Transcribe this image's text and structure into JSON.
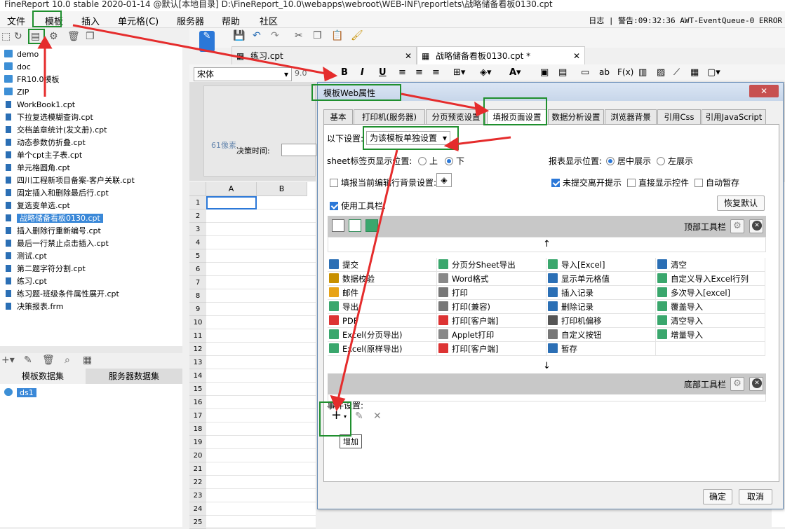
{
  "titlebar": {
    "text": "FineReport 10.0 stable 2020-01-14 @默认[本地目录]   D:\\FineReport_10.0\\webapps\\webroot\\WEB-INF\\reportlets\\战略储备看板0130.cpt"
  },
  "menubar": {
    "items": [
      "文件",
      "模板",
      "插入",
      "单元格(C)",
      "服务器",
      "帮助",
      "社区"
    ],
    "log": "日志",
    "alert": "警告:09:32:36 AWT-EventQueue-0 ERROR"
  },
  "tree": {
    "folders": [
      "demo",
      "doc",
      "FR10.0模板",
      "ZIP"
    ],
    "files": [
      "WorkBook1.cpt",
      "下拉复选模糊查询.cpt",
      "交档盖章统计(发文册).cpt",
      "动态参数仿折叠.cpt",
      "单个cpt主子表.cpt",
      "单元格圆角.cpt",
      "四川工程新项目备案-客户关联.cpt",
      "固定插入和删除最后行.cpt",
      "复选变单选.cpt",
      "战略储备看板0130.cpt",
      "插入删除行重新编号.cpt",
      "最后一行禁止点击插入.cpt",
      "测试.cpt",
      "第二题字符分割.cpt",
      "练习.cpt",
      "练习题-班级条件属性展开.cpt",
      "决策报表.frm"
    ],
    "selected_index": 9
  },
  "datasets": {
    "tabs": [
      "模板数据集",
      "服务器数据集"
    ],
    "items": [
      "ds1"
    ]
  },
  "file_tabs": [
    "练习.cpt",
    "战略储备看板0130.cpt *"
  ],
  "format": {
    "font": "宋体",
    "size": "9.0"
  },
  "design": {
    "label_px": "61像素",
    "decision_time": "决策时间:"
  },
  "sheet": {
    "cols": [
      "A",
      "B"
    ],
    "rows": [
      "1",
      "2",
      "3",
      "4",
      "5",
      "6",
      "7",
      "8",
      "9",
      "10",
      "11",
      "12",
      "13",
      "14",
      "15",
      "16",
      "17",
      "18",
      "19",
      "20",
      "21",
      "22",
      "23",
      "24",
      "25"
    ]
  },
  "dialog": {
    "title": "模板Web属性",
    "close": "✕",
    "tabs": [
      "基本",
      "打印机(服务器)",
      "分页预览设置",
      "填报页面设置",
      "数据分析设置",
      "浏览器背景",
      "引用Css",
      "引用JavaScript"
    ],
    "active_tab": "填报页面设置",
    "mode_label": "以下设置:",
    "mode_value": "为该模板单独设置",
    "sheet_pos_label": "sheet标签页显示位置:",
    "sheet_pos_top": "上",
    "sheet_pos_bottom": "下",
    "report_pos_label": "报表显示位置:",
    "report_pos_center": "居中展示",
    "report_pos_left": "左展示",
    "fill_bg": "填报当前编辑行背景设置:",
    "unsubmitted": "未提交离开提示",
    "direct_widget": "直接显示控件",
    "auto_save": "自动暂存",
    "use_toolbar": "使用工具栏:",
    "restore": "恢复默认",
    "top_toolbar": "顶部工具栏",
    "bottom_toolbar": "底部工具栏",
    "buttons": [
      [
        "提交",
        "分页分Sheet导出",
        "导入[Excel]",
        "清空"
      ],
      [
        "数据校验",
        "Word格式",
        "显示单元格值",
        "自定义导入Excel行列"
      ],
      [
        "邮件",
        "打印",
        "插入记录",
        "多次导入[excel]"
      ],
      [
        "导出",
        "打印(兼容)",
        "删除记录",
        "覆盖导入"
      ],
      [
        "PDF",
        "打印[客户端]",
        "打印机偏移",
        "清空导入"
      ],
      [
        "Excel(分页导出)",
        "Applet打印",
        "自定义按钮",
        "增量导入"
      ],
      [
        "Excel(原样导出)",
        "打印[客户端]",
        "暂存",
        ""
      ]
    ],
    "event_label": "事件设置:",
    "add_tooltip": "增加",
    "ok": "确定",
    "cancel": "取消"
  },
  "colors": {
    "accent": "#2b78d8",
    "highlight": "#1f8f2e",
    "arrow": "#e52c2c"
  }
}
